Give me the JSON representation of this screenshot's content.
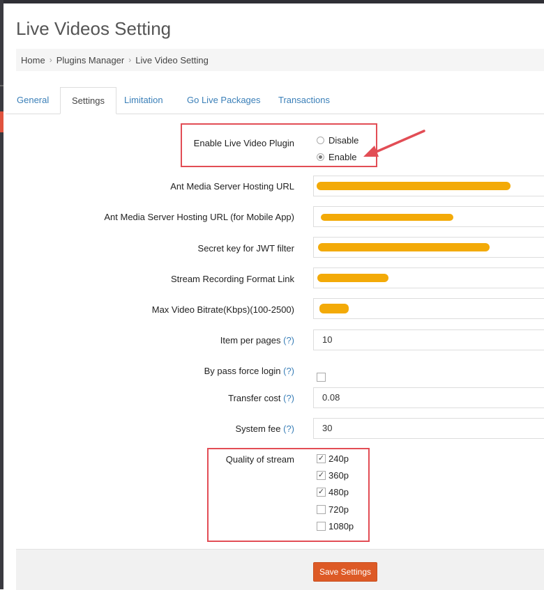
{
  "page": {
    "title": "Live Videos Setting"
  },
  "breadcrumb": [
    "Home",
    "Plugins Manager",
    "Live Video Setting"
  ],
  "tabs": [
    "General",
    "Settings",
    "Limitation",
    "Go Live Packages",
    "Transactions"
  ],
  "active_tab": "Settings",
  "form": {
    "enable_plugin": {
      "label": "Enable Live Video Plugin",
      "options": [
        "Disable",
        "Enable"
      ],
      "selected": "Enable"
    },
    "ant_media_url": {
      "label": "Ant Media Server Hosting URL"
    },
    "ant_media_url_mobile": {
      "label": "Ant Media Server Hosting URL (for Mobile App)"
    },
    "jwt_secret": {
      "label": "Secret key for JWT filter"
    },
    "recording_link": {
      "label": "Stream Recording Format Link"
    },
    "max_bitrate": {
      "label": "Max Video Bitrate(Kbps)(100-2500)"
    },
    "item_per_pages": {
      "label": "Item per pages",
      "help": "(?)",
      "value": "10"
    },
    "bypass_login": {
      "label": "By pass force login",
      "help": "(?)",
      "checked": false
    },
    "transfer_cost": {
      "label": "Transfer cost",
      "help": "(?)",
      "value": "0.08"
    },
    "system_fee": {
      "label": "System fee",
      "help": "(?)",
      "value": "30"
    },
    "quality": {
      "label": "Quality of stream",
      "options": [
        {
          "label": "240p",
          "checked": true
        },
        {
          "label": "360p",
          "checked": true
        },
        {
          "label": "480p",
          "checked": true
        },
        {
          "label": "720p",
          "checked": false
        },
        {
          "label": "1080p",
          "checked": false
        }
      ]
    }
  },
  "save_label": "Save Settings",
  "colors": {
    "accent": "#dd5a26",
    "link": "#3a7fb8",
    "highlight": "#e24d55",
    "redaction": "#f3aa08"
  }
}
